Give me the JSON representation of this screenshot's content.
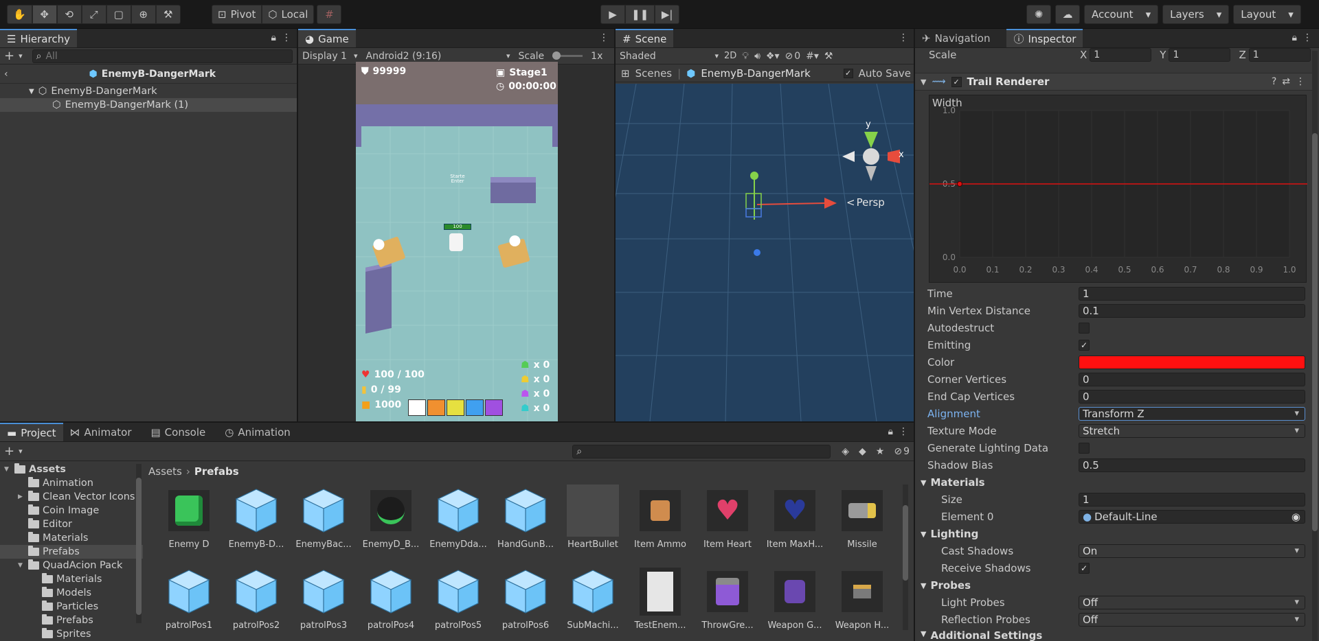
{
  "toolbar": {
    "pivot": "Pivot",
    "local": "Local",
    "account": "Account",
    "layers": "Layers",
    "layout": "Layout"
  },
  "hierarchy": {
    "tab": "Hierarchy",
    "search_placeholder": "All",
    "prefab_title": "EnemyB-DangerMark",
    "items": [
      "EnemyB-DangerMark",
      "EnemyB-DangerMark (1)"
    ]
  },
  "game": {
    "tab": "Game",
    "display": "Display 1",
    "resolution": "Android2 (9:16)",
    "scale_label": "Scale",
    "scale_value": "1x",
    "hud": {
      "score": "99999",
      "stage": "Stage1",
      "time": "00:00:00",
      "hp": "100 / 100",
      "ammo": "0 / 99",
      "coins": "1000",
      "enemy_counts": [
        "x 0",
        "x 0",
        "x 0",
        "x 0"
      ],
      "player_hp": "100",
      "sign": "Starte Enter"
    }
  },
  "scene": {
    "tab": "Scene",
    "shading": "Shaded",
    "mode_2d": "2D",
    "hidden_count": "0",
    "breadcrumb_scenes": "Scenes",
    "breadcrumb_prefab": "EnemyB-DangerMark",
    "auto_save": "Auto Save",
    "gizmo_y": "y",
    "gizmo_x": "x",
    "persp": "Persp"
  },
  "inspector": {
    "tab_nav": "Navigation",
    "tab_inspector": "Inspector",
    "scale_label": "Scale",
    "scale": {
      "x_label": "X",
      "x": "1",
      "y_label": "Y",
      "y": "1",
      "z_label": "Z",
      "z": "1"
    },
    "component": "Trail Renderer",
    "curve": {
      "label": "Width",
      "y_ticks": [
        "1.0",
        "0.5",
        "0.0"
      ],
      "x_ticks": [
        "0.0",
        "0.1",
        "0.2",
        "0.3",
        "0.4",
        "0.5",
        "0.6",
        "0.7",
        "0.8",
        "0.9",
        "1.0"
      ],
      "value": 0.5
    },
    "props": {
      "time_label": "Time",
      "time": "1",
      "minvert_label": "Min Vertex Distance",
      "minvert": "0.1",
      "autodestruct_label": "Autodestruct",
      "emitting_label": "Emitting",
      "color_label": "Color",
      "color": "#ff1010",
      "corner_label": "Corner Vertices",
      "corner": "0",
      "endcap_label": "End Cap Vertices",
      "endcap": "0",
      "alignment_label": "Alignment",
      "alignment": "Transform Z",
      "texture_label": "Texture Mode",
      "texture": "Stretch",
      "genlight_label": "Generate Lighting Data",
      "shadowbias_label": "Shadow Bias",
      "shadowbias": "0.5"
    },
    "materials": {
      "section": "Materials",
      "size_label": "Size",
      "size": "1",
      "element_label": "Element 0",
      "element": "Default-Line"
    },
    "lighting": {
      "section": "Lighting",
      "cast_label": "Cast Shadows",
      "cast": "On",
      "receive_label": "Receive Shadows"
    },
    "probes": {
      "section": "Probes",
      "light_label": "Light Probes",
      "light": "Off",
      "reflection_label": "Reflection Probes",
      "reflection": "Off"
    },
    "additional": "Additional Settings"
  },
  "project": {
    "tabs": [
      "Project",
      "Animator",
      "Console",
      "Animation"
    ],
    "hidden_count": "9",
    "breadcrumb": [
      "Assets",
      "Prefabs"
    ],
    "tree": [
      {
        "label": "Assets",
        "depth": 0,
        "open": true,
        "bold": true
      },
      {
        "label": "Animation",
        "depth": 1
      },
      {
        "label": "Clean Vector Icons",
        "depth": 1,
        "collapsed": true
      },
      {
        "label": "Coin Image",
        "depth": 1
      },
      {
        "label": "Editor",
        "depth": 1
      },
      {
        "label": "Materials",
        "depth": 1
      },
      {
        "label": "Prefabs",
        "depth": 1,
        "selected": true
      },
      {
        "label": "QuadAcion Pack",
        "depth": 1,
        "open": true
      },
      {
        "label": "Materials",
        "depth": 2
      },
      {
        "label": "Models",
        "depth": 2
      },
      {
        "label": "Particles",
        "depth": 2
      },
      {
        "label": "Prefabs",
        "depth": 2
      },
      {
        "label": "Sprites",
        "depth": 2
      }
    ],
    "assets": [
      {
        "name": "Enemy D",
        "kind": "enemyd"
      },
      {
        "name": "EnemyB-D...",
        "kind": "cube"
      },
      {
        "name": "EnemyBac...",
        "kind": "cube"
      },
      {
        "name": "EnemyD_B...",
        "kind": "ball"
      },
      {
        "name": "EnemyDda...",
        "kind": "cube"
      },
      {
        "name": "HandGunB...",
        "kind": "cube"
      },
      {
        "name": "HeartBullet",
        "kind": "blank"
      },
      {
        "name": "Item Ammo",
        "kind": "ammo"
      },
      {
        "name": "Item Heart",
        "kind": "heart"
      },
      {
        "name": "Item MaxH...",
        "kind": "maxheart"
      },
      {
        "name": "Missile",
        "kind": "missile"
      },
      {
        "name": "patrolPos1",
        "kind": "cube"
      },
      {
        "name": "patrolPos2",
        "kind": "cube"
      },
      {
        "name": "patrolPos3",
        "kind": "cube"
      },
      {
        "name": "patrolPos4",
        "kind": "cube"
      },
      {
        "name": "patrolPos5",
        "kind": "cube"
      },
      {
        "name": "patrolPos6",
        "kind": "cube"
      },
      {
        "name": "SubMachi...",
        "kind": "cube"
      },
      {
        "name": "TestEnem...",
        "kind": "white"
      },
      {
        "name": "ThrowGre...",
        "kind": "grenade"
      },
      {
        "name": "Weapon G...",
        "kind": "weapong"
      },
      {
        "name": "Weapon H...",
        "kind": "weaponh"
      }
    ]
  }
}
